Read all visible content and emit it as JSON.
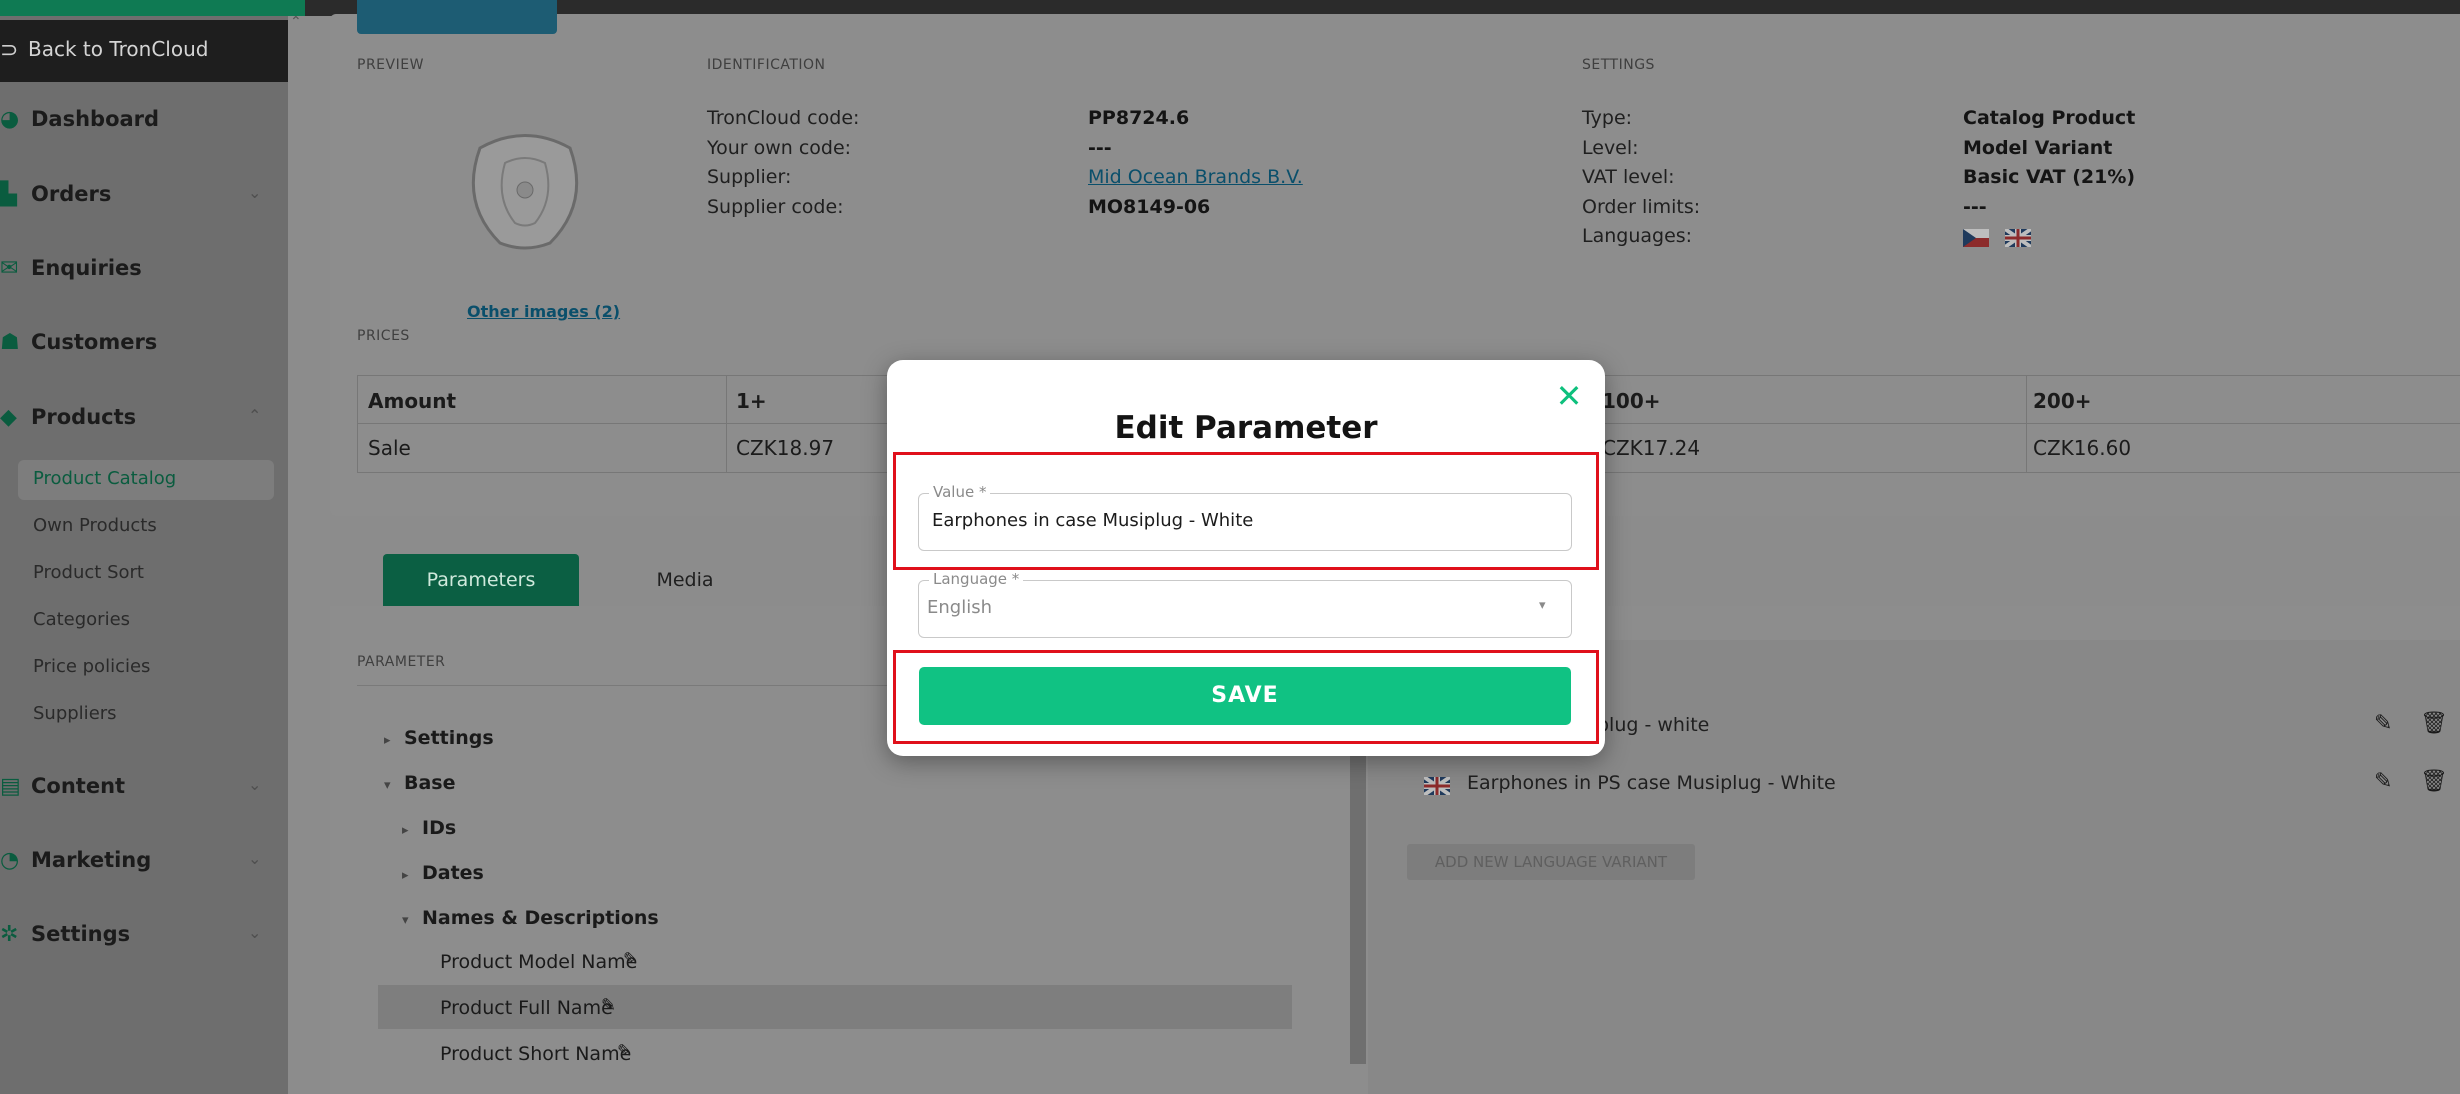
{
  "sidebar": {
    "back_label": "Back to TronCloud",
    "items": [
      {
        "label": "Dashboard",
        "icon": "dashboard-icon"
      },
      {
        "label": "Orders",
        "icon": "cart-icon"
      },
      {
        "label": "Enquiries",
        "icon": "enquiries-icon"
      },
      {
        "label": "Customers",
        "icon": "customers-icon"
      },
      {
        "label": "Products",
        "icon": "tag-icon"
      },
      {
        "label": "Content",
        "icon": "content-icon"
      },
      {
        "label": "Marketing",
        "icon": "marketing-icon"
      },
      {
        "label": "Settings",
        "icon": "gear-icon"
      }
    ],
    "subitems": [
      "Product Catalog",
      "Own Products",
      "Product Sort",
      "Categories",
      "Price policies",
      "Suppliers"
    ],
    "active_subitem": "Product Catalog"
  },
  "preview": {
    "section": "PREVIEW",
    "other_images": "Other images (2)"
  },
  "identification": {
    "section": "IDENTIFICATION",
    "rows": [
      {
        "label": "TronCloud code:",
        "value": "PP8724.6"
      },
      {
        "label": "Your own code:",
        "value": "---"
      },
      {
        "label": "Supplier:",
        "value": "Mid Ocean Brands B.V."
      },
      {
        "label": "Supplier code:",
        "value": "MO8149-06"
      }
    ]
  },
  "settings": {
    "section": "SETTINGS",
    "rows": [
      {
        "label": "Type:",
        "value": "Catalog Product"
      },
      {
        "label": "Level:",
        "value": "Model Variant"
      },
      {
        "label": "VAT level:",
        "value": "Basic VAT (21%)"
      },
      {
        "label": "Order limits:",
        "value": "---"
      },
      {
        "label": "Languages:",
        "value": ""
      }
    ]
  },
  "prices": {
    "section": "PRICES",
    "headers": [
      "Amount",
      "1+",
      "100+",
      "200+"
    ],
    "row": [
      "Sale",
      "CZK18.97",
      "CZK17.24",
      "CZK16.60"
    ]
  },
  "tabs": {
    "parameters": "Parameters",
    "media": "Media"
  },
  "parameter": {
    "section": "PARAMETER",
    "tree": [
      "Settings",
      "Base",
      "IDs",
      "Dates",
      "Names & Descriptions",
      "Product Model Name",
      "Product Full Name",
      "Product Short Name"
    ]
  },
  "variants": {
    "rows": [
      "plug - white",
      "Earphones in PS case Musiplug - White"
    ],
    "add_label": "ADD NEW LANGUAGE VARIANT"
  },
  "modal": {
    "title": "Edit Parameter",
    "value_label": "Value *",
    "value": "Earphones in case Musiplug - White",
    "language_label": "Language *",
    "language_value": "English",
    "save_label": "SAVE"
  },
  "colors": {
    "accent": "#10c283",
    "annotation": "#e0101b"
  }
}
